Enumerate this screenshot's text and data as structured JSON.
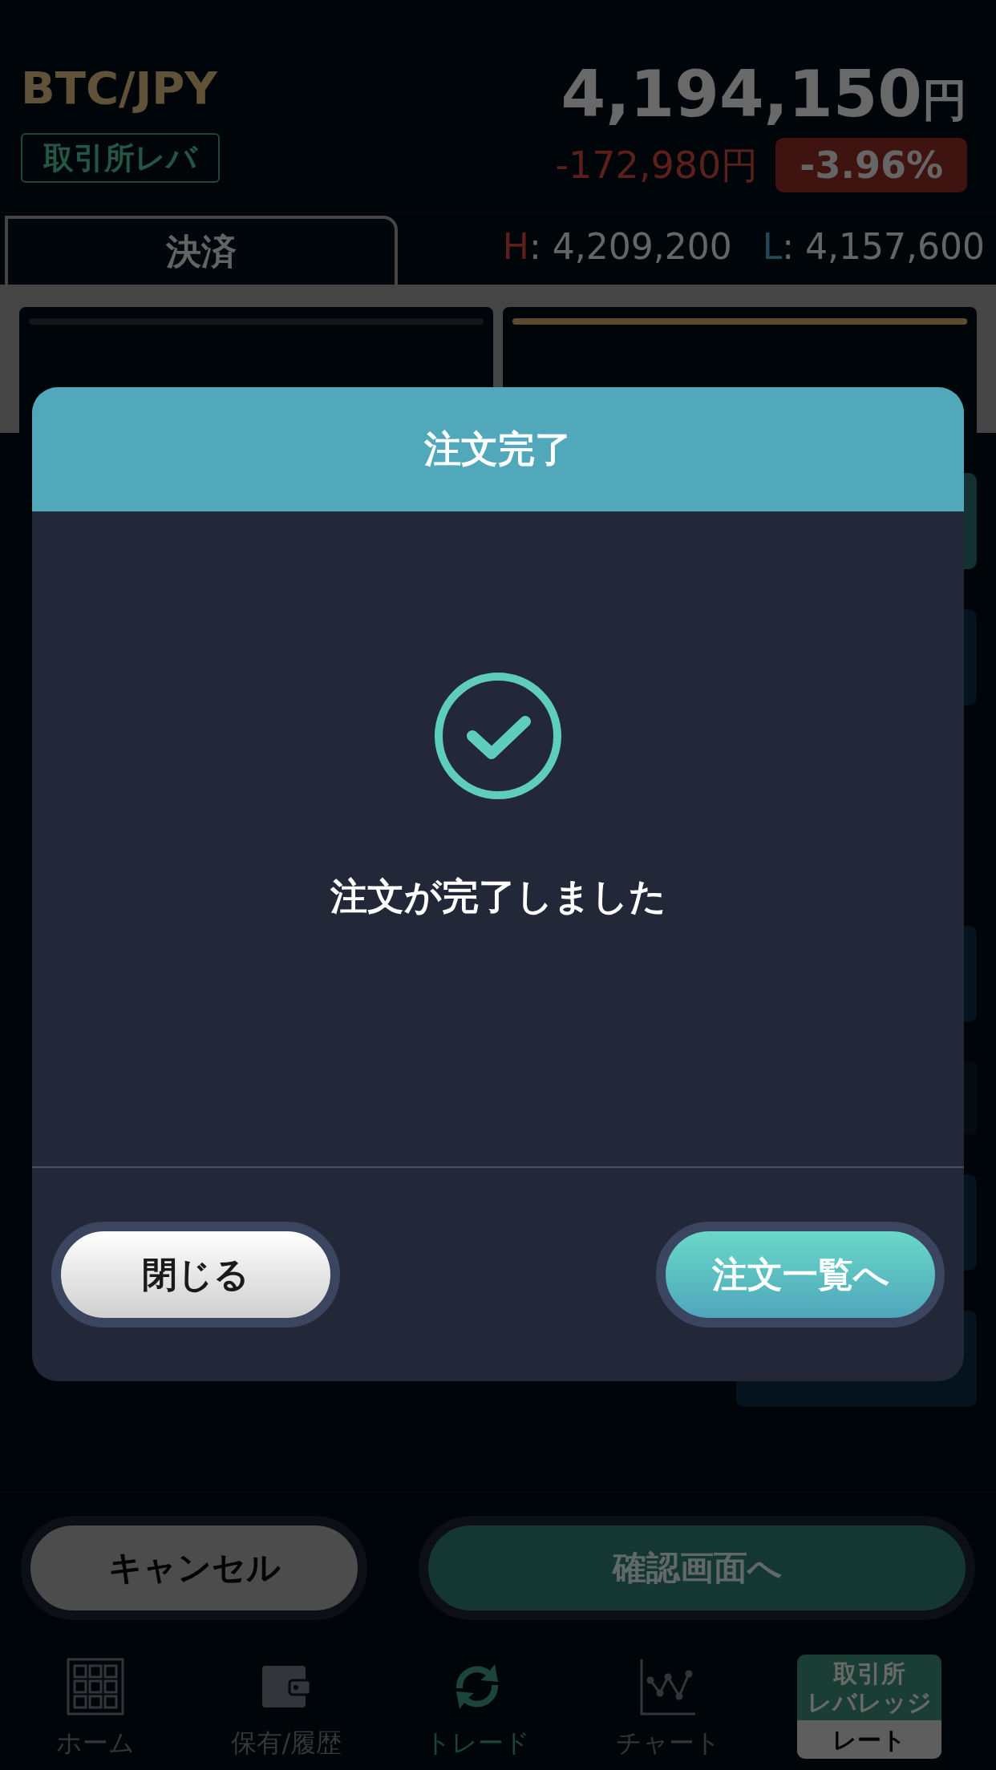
{
  "header": {
    "pair": "BTC/JPY",
    "badge": "取引所レバ",
    "price": "4,194,150",
    "price_unit": "円",
    "change": "-172,980円",
    "change_percent": "-3.96%"
  },
  "tabs": [
    {
      "label": "決済",
      "selected": true
    }
  ],
  "range": {
    "high_label": "H",
    "high_sep": ":",
    "high": "4,209,200",
    "low_label": "L",
    "low_sep": ":",
    "low": "4,157,600"
  },
  "order_types": [
    {
      "selected": false
    },
    {
      "selected": true
    }
  ],
  "actions": [
    {
      "label": "キャンセル",
      "kind": "cancel"
    },
    {
      "label": "確認画面へ",
      "kind": "confirm"
    }
  ],
  "nav": [
    {
      "label": "ホーム",
      "selected": false
    },
    {
      "label": "保有/履歴",
      "selected": false
    },
    {
      "label": "トレード",
      "selected": true
    },
    {
      "label": "チャート",
      "selected": false
    }
  ],
  "mode_tile": {
    "title_lines": [
      "取引所",
      "レバレッジ"
    ],
    "subtitle": "レート"
  },
  "dialog": {
    "title": "注文完了",
    "message": "注文が完了しました",
    "buttons": [
      {
        "label": "閉じる",
        "kind": "secondary"
      },
      {
        "label": "注文一覧へ",
        "kind": "primary"
      }
    ]
  }
}
